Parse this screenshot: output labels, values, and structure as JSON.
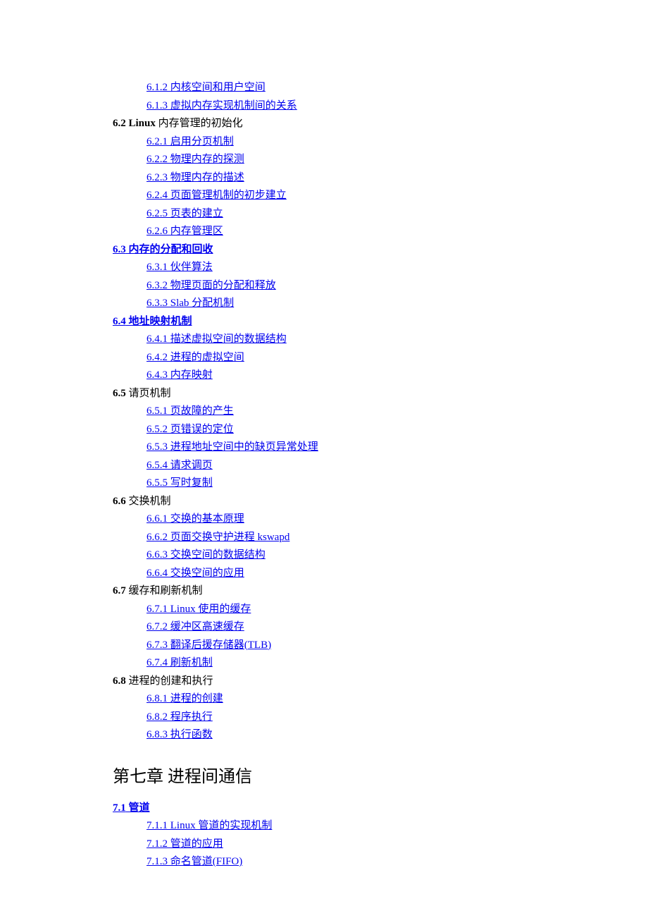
{
  "sections": {
    "s612": "6.1.2  内核空间和用户空间",
    "s613": "6.1.3  虚拟内存实现机制间的关系",
    "h62_num": "6.2 Linux ",
    "h62_txt": "内存管理的初始化",
    "s621": "6.2.1  启用分页机制",
    "s622": "6.2.2   物理内存的探测",
    "s623": "6.2.3  物理内存的描述",
    "s624": "6.2.4  页面管理机制的初步建立",
    "s625": "6.2.5 页表的建立",
    "s626": "6.2.6 内存管理区",
    "h63_lnk": "6.3",
    "h63_txt": " 内存的分配和回收",
    "s631": "6.3.1  伙伴算法",
    "s632": "6.3.2  物理页面的分配和释放",
    "s633": "6.3.3 Slab 分配机制",
    "h64_lnk": "6.4",
    "h64_txt": " 地址映射机制",
    "s641": "6.4.1  描述虚拟空间的数据结构",
    "s642": "6.4.2  进程的虚拟空间",
    "s643": "6.4.3  内存映射",
    "h65_num": "6.5",
    "h65_txt": "  请页机制",
    "s651": "6.5.1    页故障的产生",
    "s652": "6.5.2  页错误的定位",
    "s653": "6.5.3  进程地址空间中的缺页异常处理",
    "s654": "6.5.4  请求调页",
    "s655": "6.5.5  写时复制",
    "h66_num": "6.6",
    "h66_txt": "  交换机制",
    "s661": "6.6.1  交换的基本原理",
    "s662": "6.6.2  页面交换守护进程 kswapd",
    "s663": "6.6.3  交换空间的数据结构",
    "s664": "6.6.4  交换空间的应用",
    "h67_num": "6.7",
    "h67_txt": "  缓存和刷新机制",
    "s671": "6.7.1 Linux 使用的缓存",
    "s672": "6.7.2  缓冲区高速缓存",
    "s673": "6.7.3  翻译后援存储器(TLB)",
    "s674": "6.7.4  刷新机制",
    "h68_num": "6.8",
    "h68_txt": "  进程的创建和执行",
    "s681": "6.8.1  进程的创建",
    "s682": "6.8.2  程序执行",
    "s683": "6.8.3  执行函数",
    "ch7": "第七章  进程间通信",
    "h71_lnk": "7.1",
    "h71_txt": " 管道",
    "s711": "7.1.1 Linux 管道的实现机制",
    "s712": "7.1.2  管道的应用",
    "s713": "7.1.3  命名管道(FIFO)"
  }
}
